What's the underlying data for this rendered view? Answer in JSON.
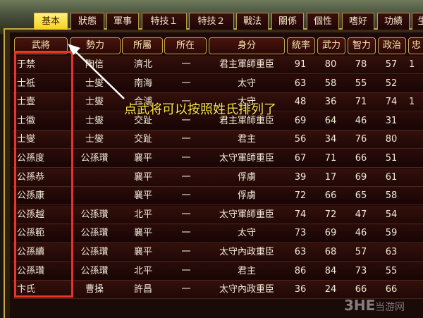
{
  "tabs": [
    {
      "label": "基本",
      "active": true
    },
    {
      "label": "狀態"
    },
    {
      "label": "軍事"
    },
    {
      "label": "特技１"
    },
    {
      "label": "特技２"
    },
    {
      "label": "戰法"
    },
    {
      "label": "關係"
    },
    {
      "label": "個性"
    },
    {
      "label": "嗜好"
    },
    {
      "label": "功績"
    },
    {
      "label": "生"
    }
  ],
  "columns": [
    "武將",
    "勢力",
    "所屬",
    "所在",
    "身分",
    "統率",
    "武力",
    "智力",
    "政治",
    "忠"
  ],
  "rows": [
    {
      "name": "于禁",
      "force": "陶信",
      "city": "濟北",
      "loc": "一",
      "rank": "君主軍師重臣",
      "lead": "91",
      "war": "80",
      "int": "78",
      "pol": "57",
      "loy": "1"
    },
    {
      "name": "士祗",
      "force": "士燮",
      "city": "南海",
      "loc": "一",
      "rank": "太守",
      "lead": "63",
      "war": "58",
      "int": "55",
      "pol": "52",
      "loy": ""
    },
    {
      "name": "士壹",
      "force": "士燮",
      "city": "合浦",
      "loc": "一",
      "rank": "太守",
      "lead": "48",
      "war": "36",
      "int": "71",
      "pol": "74",
      "loy": "1"
    },
    {
      "name": "士徽",
      "force": "士燮",
      "city": "交趾",
      "loc": "一",
      "rank": "君主軍師重臣",
      "lead": "69",
      "war": "64",
      "int": "46",
      "pol": "31",
      "loy": ""
    },
    {
      "name": "士燮",
      "force": "士燮",
      "city": "交趾",
      "loc": "一",
      "rank": "君主",
      "lead": "56",
      "war": "34",
      "int": "76",
      "pol": "80",
      "loy": ""
    },
    {
      "name": "公孫度",
      "force": "公孫瓚",
      "city": "襄平",
      "loc": "一",
      "rank": "太守軍師重臣",
      "lead": "67",
      "war": "71",
      "int": "66",
      "pol": "51",
      "loy": ""
    },
    {
      "name": "公孫恭",
      "force": "",
      "city": "襄平",
      "loc": "一",
      "rank": "俘虜",
      "lead": "39",
      "war": "17",
      "int": "69",
      "pol": "61",
      "loy": ""
    },
    {
      "name": "公孫康",
      "force": "",
      "city": "襄平",
      "loc": "一",
      "rank": "俘虜",
      "lead": "72",
      "war": "66",
      "int": "65",
      "pol": "58",
      "loy": ""
    },
    {
      "name": "公孫越",
      "force": "公孫瓚",
      "city": "北平",
      "loc": "一",
      "rank": "太守軍師重臣",
      "lead": "74",
      "war": "72",
      "int": "47",
      "pol": "54",
      "loy": ""
    },
    {
      "name": "公孫範",
      "force": "公孫瓚",
      "city": "襄平",
      "loc": "一",
      "rank": "太守",
      "lead": "73",
      "war": "69",
      "int": "46",
      "pol": "59",
      "loy": ""
    },
    {
      "name": "公孫續",
      "force": "公孫瓚",
      "city": "襄平",
      "loc": "一",
      "rank": "太守內政重臣",
      "lead": "63",
      "war": "68",
      "int": "57",
      "pol": "63",
      "loy": ""
    },
    {
      "name": "公孫瓚",
      "force": "公孫瓚",
      "city": "北平",
      "loc": "一",
      "rank": "君主",
      "lead": "86",
      "war": "84",
      "int": "73",
      "pol": "55",
      "loy": ""
    },
    {
      "name": "卞氏",
      "force": "曹操",
      "city": "許昌",
      "loc": "一",
      "rank": "太守內政重臣",
      "lead": "36",
      "war": "24",
      "int": "66",
      "pol": "66",
      "loy": ""
    }
  ],
  "annotation": {
    "text": "点武将可以按照姓氏排列了",
    "arrow_color": "#ffffff",
    "box_color": "#e8342c",
    "text_color": "#ffe44a"
  },
  "watermark": {
    "brand": "3HE",
    "site": "当游网"
  },
  "colors": {
    "accent_tab": "#f5d020",
    "header_border": "#c8a548",
    "row_bg": "#2a0c0a"
  }
}
